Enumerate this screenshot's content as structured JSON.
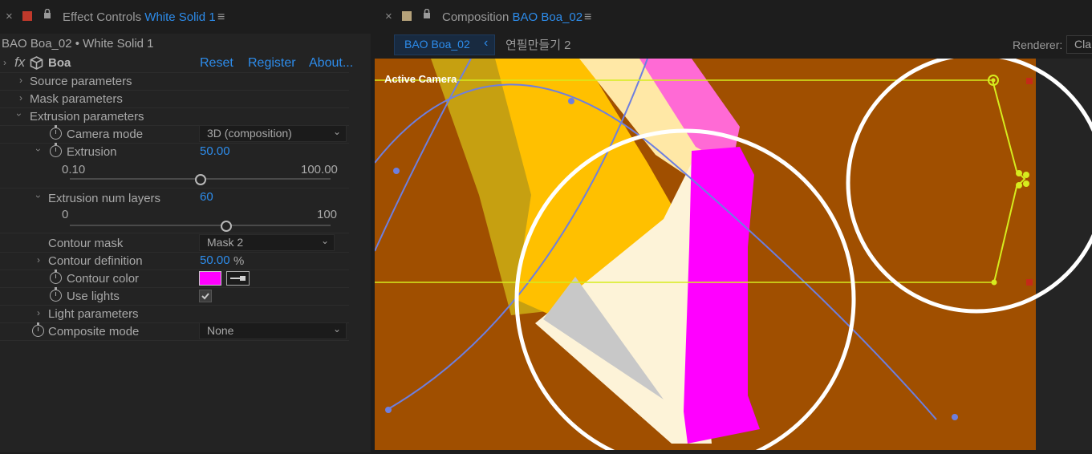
{
  "effect_controls": {
    "tab": {
      "close": "×",
      "title_prefix": "Effect Controls",
      "title_layer": "White Solid 1",
      "menu": "≡",
      "swatch_color": "#c0392b"
    },
    "layer_path": "BAO Boa_02 • White Solid 1",
    "effect": {
      "fx": "fx",
      "name": "Boa",
      "reset": "Reset",
      "register": "Register",
      "about": "About..."
    },
    "groups": {
      "source": "Source parameters",
      "mask": "Mask parameters",
      "extrusion": "Extrusion parameters",
      "light": "Light parameters"
    },
    "params": {
      "camera_mode": {
        "label": "Camera mode",
        "value": "3D (composition)"
      },
      "extrusion": {
        "label": "Extrusion",
        "value": "50.00",
        "min": "0.10",
        "max": "100.00",
        "slider_fraction": 0.5
      },
      "extrusion_layers": {
        "label": "Extrusion num layers",
        "value": "60",
        "min": "0",
        "max": "100",
        "slider_fraction": 0.6
      },
      "contour_mask": {
        "label": "Contour mask",
        "value": "Mask 2"
      },
      "contour_definition": {
        "label": "Contour definition",
        "value": "50.00",
        "unit": "%"
      },
      "contour_color": {
        "label": "Contour color",
        "value": "#ff00ff"
      },
      "use_lights": {
        "label": "Use lights",
        "checked": true
      },
      "composite_mode": {
        "label": "Composite mode",
        "value": "None"
      }
    }
  },
  "composition": {
    "tab": {
      "close": "×",
      "title_prefix": "Composition",
      "title_comp": "BAO Boa_02",
      "menu": "≡",
      "swatch_color": "#b5a27a"
    },
    "active_comp_tab": "BAO Boa_02",
    "other_comp_tab": "연필만들기 2",
    "renderer_label": "Renderer:",
    "renderer_value": "Cla",
    "viewer_label": "Active Camera",
    "colors": {
      "background": "#a04f00",
      "guide": "#d6ec1e",
      "path": "#6d7fe0",
      "magenta": "#ff00ff",
      "yellow": "#ffc000"
    }
  }
}
